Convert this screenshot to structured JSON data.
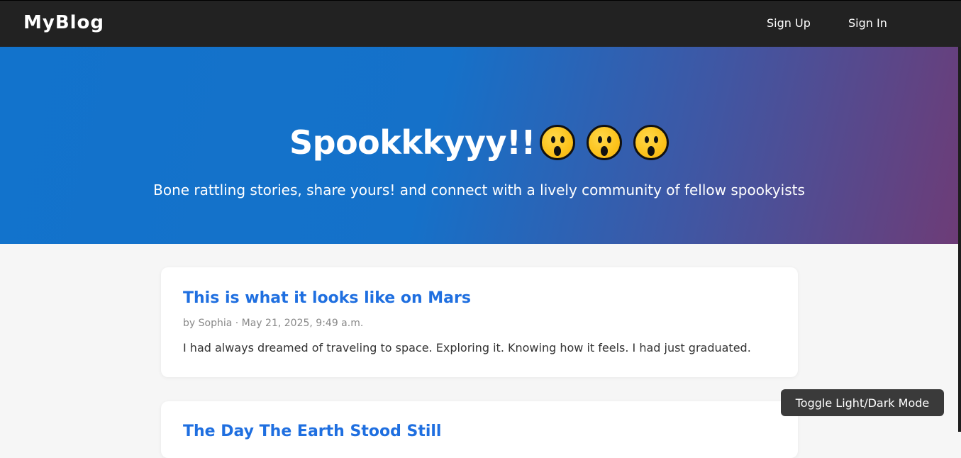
{
  "navbar": {
    "brand": "MyBlog",
    "links": [
      "Sign Up",
      "Sign In"
    ]
  },
  "hero": {
    "title": "Spookkkyyy!!",
    "emojis": [
      "astonished-face",
      "astonished-face",
      "astonished-face"
    ],
    "subtitle": "Bone rattling stories, share yours! and connect with a lively community of fellow spookyists"
  },
  "posts": [
    {
      "title": "This is what it looks like on Mars",
      "meta": "by Sophia · May 21, 2025, 9:49 a.m.",
      "excerpt": "I had always dreamed of traveling to space. Exploring it. Knowing how it feels. I had just graduated."
    },
    {
      "title": "The Day The Earth Stood Still"
    }
  ],
  "theme_toggle": {
    "label": "Toggle Light/Dark Mode"
  },
  "colors": {
    "navbar": "#222222",
    "hero_start": "#1273cc",
    "hero_end": "#6d3c77",
    "link": "#1f6fe0",
    "page_bg": "#f6f6f6"
  }
}
